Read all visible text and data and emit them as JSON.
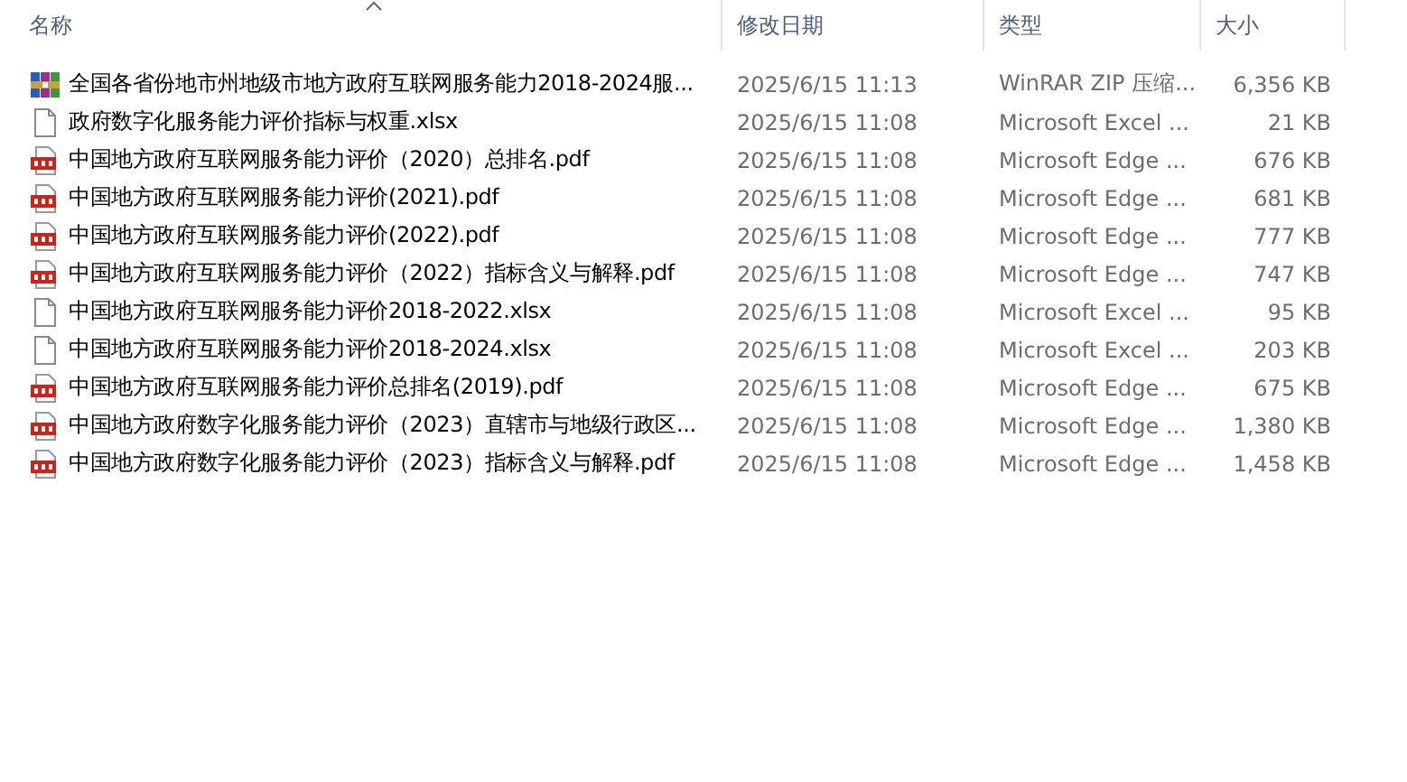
{
  "columns": [
    {
      "label": "名称",
      "sorted": true
    },
    {
      "label": "修改日期",
      "sorted": false
    },
    {
      "label": "类型",
      "sorted": false
    },
    {
      "label": "大小",
      "sorted": false
    }
  ],
  "files": [
    {
      "kind": "zip",
      "name": "全国各省份地市州地级市地方政府互联网服务能力2018-2024服...",
      "modified": "2025/6/15 11:13",
      "type": "WinRAR ZIP 压缩...",
      "size": "6,356 KB"
    },
    {
      "kind": "sheet",
      "name": "政府数字化服务能力评价指标与权重.xlsx",
      "modified": "2025/6/15 11:08",
      "type": "Microsoft Excel ...",
      "size": "21 KB"
    },
    {
      "kind": "pdf",
      "name": "中国地方政府互联网服务能力评价（2020）总排名.pdf",
      "modified": "2025/6/15 11:08",
      "type": "Microsoft Edge ...",
      "size": "676 KB"
    },
    {
      "kind": "pdf",
      "name": "中国地方政府互联网服务能力评价(2021).pdf",
      "modified": "2025/6/15 11:08",
      "type": "Microsoft Edge ...",
      "size": "681 KB"
    },
    {
      "kind": "pdf",
      "name": "中国地方政府互联网服务能力评价(2022).pdf",
      "modified": "2025/6/15 11:08",
      "type": "Microsoft Edge ...",
      "size": "777 KB"
    },
    {
      "kind": "pdf",
      "name": "中国地方政府互联网服务能力评价（2022）指标含义与解释.pdf",
      "modified": "2025/6/15 11:08",
      "type": "Microsoft Edge ...",
      "size": "747 KB"
    },
    {
      "kind": "sheet",
      "name": "中国地方政府互联网服务能力评价2018-2022.xlsx",
      "modified": "2025/6/15 11:08",
      "type": "Microsoft Excel ...",
      "size": "95 KB"
    },
    {
      "kind": "sheet",
      "name": "中国地方政府互联网服务能力评价2018-2024.xlsx",
      "modified": "2025/6/15 11:08",
      "type": "Microsoft Excel ...",
      "size": "203 KB"
    },
    {
      "kind": "pdf",
      "name": "中国地方政府互联网服务能力评价总排名(2019).pdf",
      "modified": "2025/6/15 11:08",
      "type": "Microsoft Edge ...",
      "size": "675 KB"
    },
    {
      "kind": "pdf",
      "name": "中国地方政府数字化服务能力评价（2023）直辖市与地级行政区...",
      "modified": "2025/6/15 11:08",
      "type": "Microsoft Edge ...",
      "size": "1,380 KB"
    },
    {
      "kind": "pdf",
      "name": "中国地方政府数字化服务能力评价（2023）指标含义与解释.pdf",
      "modified": "2025/6/15 11:08",
      "type": "Microsoft Edge ...",
      "size": "1,458 KB"
    }
  ]
}
